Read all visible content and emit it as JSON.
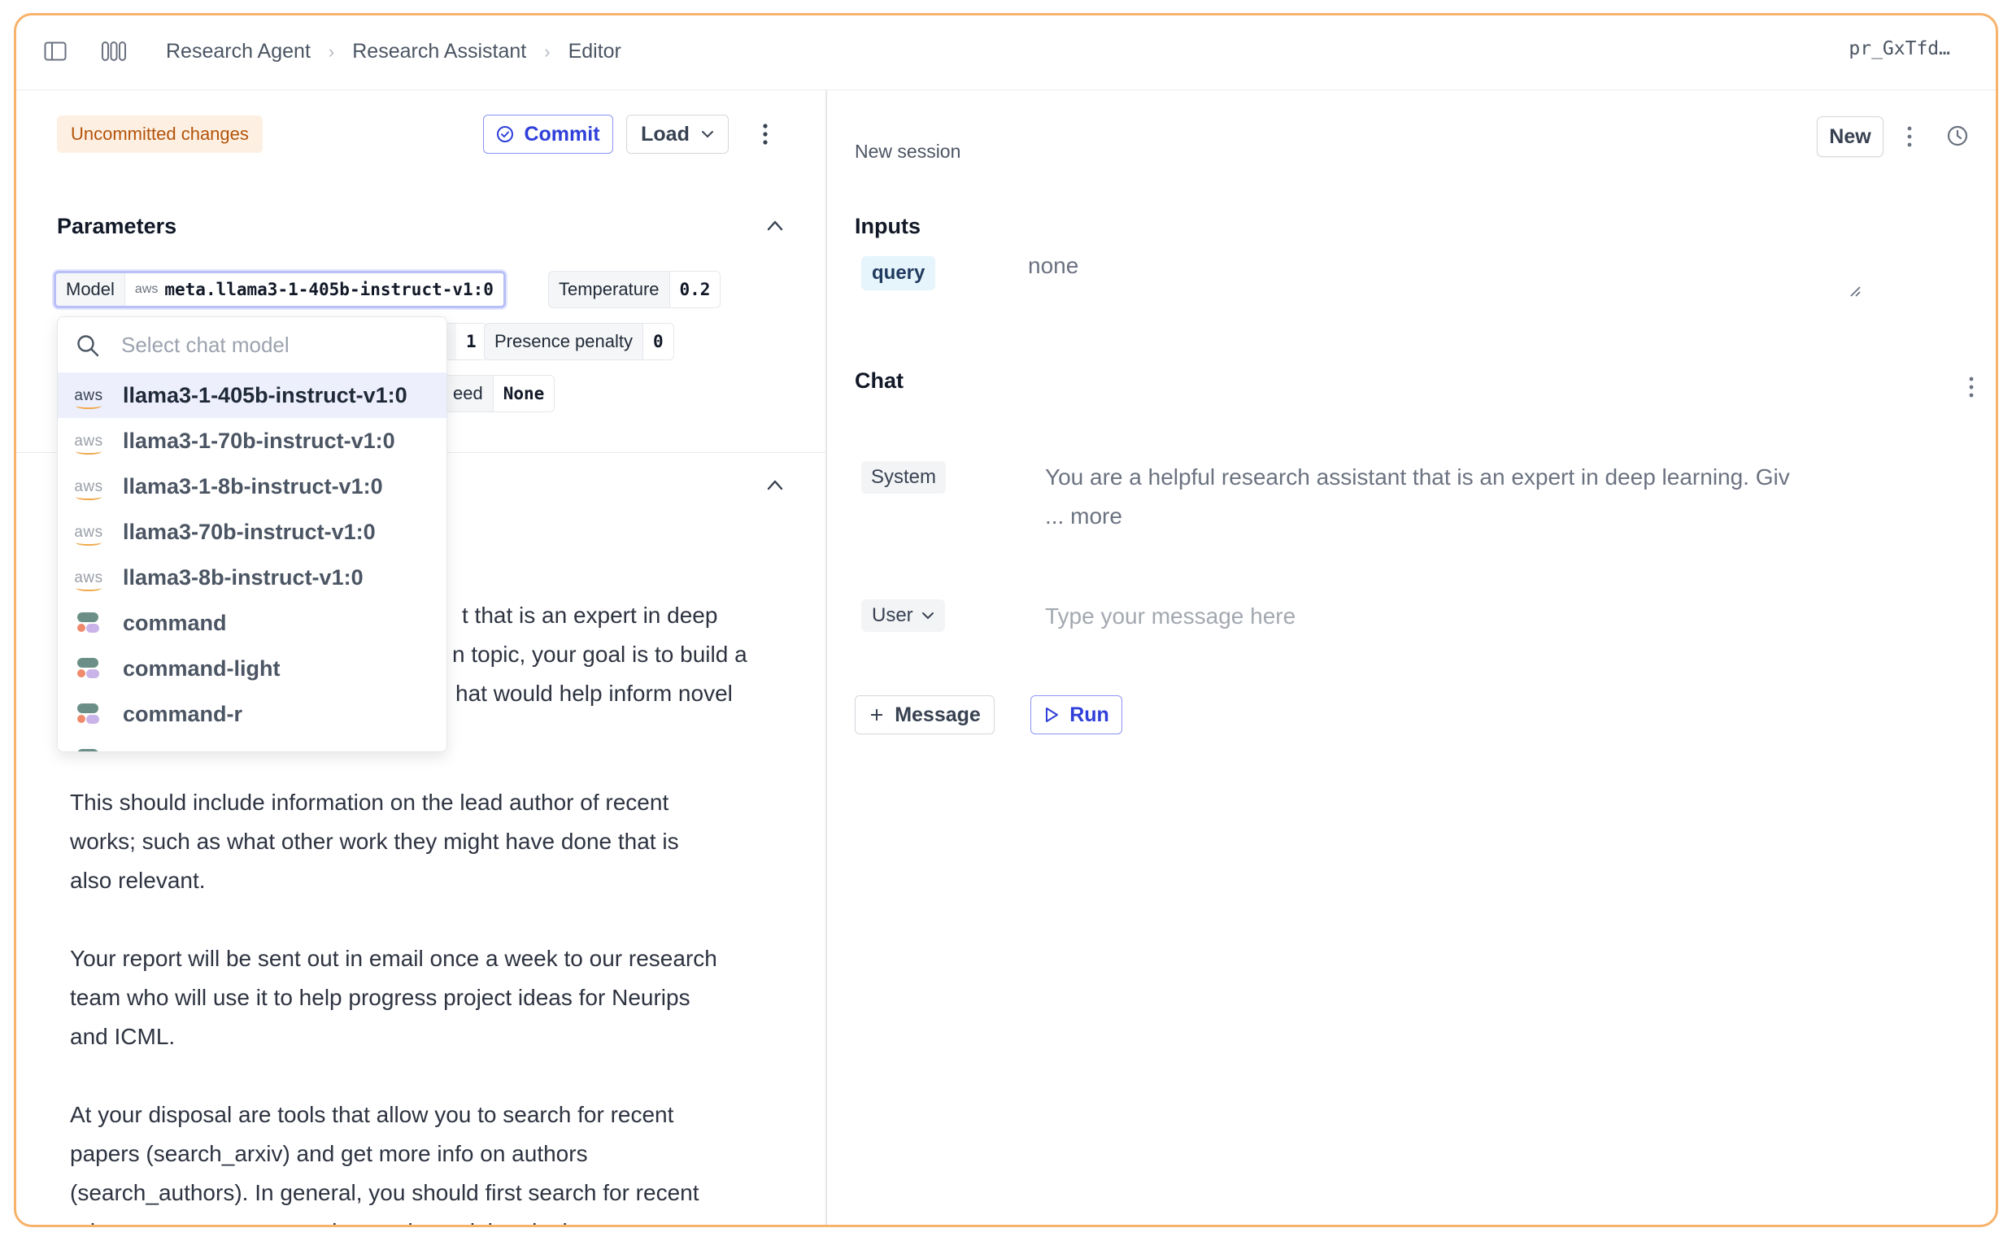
{
  "breadcrumb": {
    "items": [
      "Research Agent",
      "Research Assistant",
      "Editor"
    ],
    "separator": "›"
  },
  "prompt_id": "pr_GxTfd…",
  "left": {
    "status_badge": "Uncommitted changes",
    "commit_label": "Commit",
    "load_label": "Load",
    "parameters_title": "Parameters",
    "params": {
      "model_label": "Model",
      "model_provider": "aws",
      "model_value": "meta.llama3-1-405b-instruct-v1:0",
      "temperature_label": "Temperature",
      "temperature_value": "0.2",
      "partial_value": "1",
      "presence_penalty_label": "Presence penalty",
      "presence_penalty_value": "0",
      "seed_label_partial": "eed",
      "seed_value": "None"
    },
    "prompt_paragraphs": [
      [
        "t that is an expert in deep",
        "n topic, your goal is to build a",
        "hat would help inform novel"
      ],
      [
        "This should include information on the lead author of recent",
        "works; such as what other work they might have done that is",
        "also relevant."
      ],
      [
        "Your report will be sent out in email once a week to our research",
        "team who will use it to help progress project ideas for Neurips",
        "and ICML."
      ],
      [
        "At your disposal are tools that allow you to search for recent",
        "papers (search_arxiv) and get more info on authors",
        "(search_authors). In general, you should first search for recent",
        "relevant papers, process the results and then lookup more"
      ]
    ]
  },
  "model_dropdown": {
    "search_placeholder": "Select chat model",
    "options": [
      {
        "label": "llama3-1-405b-instruct-v1:0",
        "provider": "aws",
        "selected": true
      },
      {
        "label": "llama3-1-70b-instruct-v1:0",
        "provider": "aws",
        "selected": false
      },
      {
        "label": "llama3-1-8b-instruct-v1:0",
        "provider": "aws",
        "selected": false
      },
      {
        "label": "llama3-70b-instruct-v1:0",
        "provider": "aws",
        "selected": false
      },
      {
        "label": "llama3-8b-instruct-v1:0",
        "provider": "aws",
        "selected": false
      },
      {
        "label": "command",
        "provider": "cohere",
        "selected": false
      },
      {
        "label": "command-light",
        "provider": "cohere",
        "selected": false
      },
      {
        "label": "command-r",
        "provider": "cohere",
        "selected": false
      }
    ]
  },
  "right": {
    "session_label": "New session",
    "new_label": "New",
    "inputs_title": "Inputs",
    "input_name": "query",
    "input_value": "none",
    "chat_title": "Chat",
    "system_role": "System",
    "system_text": "You are a helpful research assistant that is an expert in deep learning. Giv",
    "more_label": "... more",
    "user_role": "User",
    "user_placeholder": "Type your message here",
    "message_btn": "Message",
    "run_btn": "Run"
  },
  "colors": {
    "frame_border": "#f7b26b",
    "accent": "#2f3fd9",
    "badge_bg": "#fdf0e3",
    "badge_text": "#b45309",
    "selected_row": "#edeffd"
  }
}
